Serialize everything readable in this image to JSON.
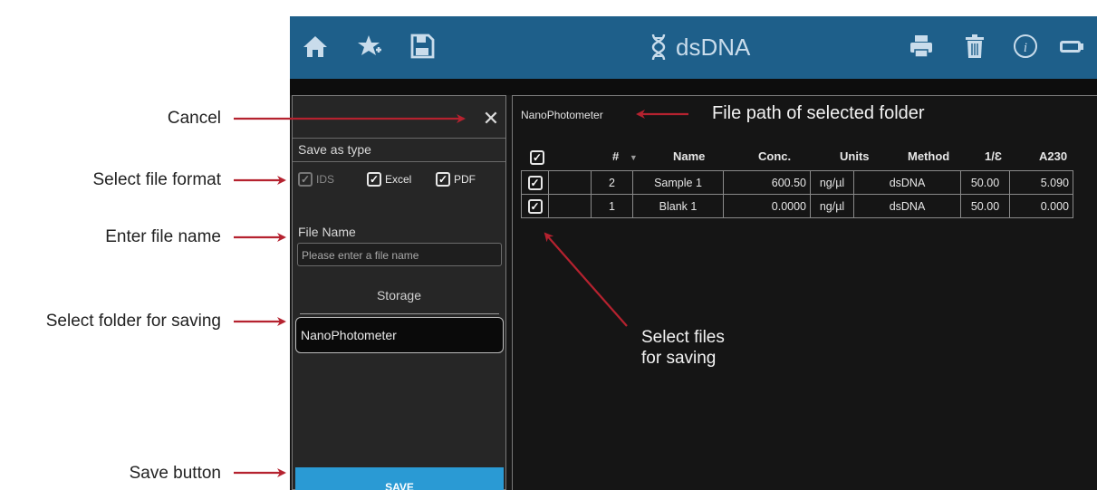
{
  "annotations": {
    "cancel": "Cancel",
    "select_file_format": "Select file format",
    "enter_file_name": "Enter file name",
    "select_folder": "Select folder for saving",
    "save_button": "Save button",
    "file_path": "File path of selected folder",
    "select_files_line1": "Select files",
    "select_files_line2": "for saving"
  },
  "topbar": {
    "title": "dsDNA",
    "left_icons": [
      "home-icon",
      "favorite-star-icon",
      "save-disk-icon"
    ],
    "right_icons": [
      "printer-icon",
      "trash-icon",
      "info-icon",
      "battery-icon"
    ],
    "color": "#1e5f8a"
  },
  "save_panel": {
    "save_as_type_label": "Save as type",
    "formats": [
      {
        "label": "IDS",
        "checked": true,
        "enabled": false
      },
      {
        "label": "Excel",
        "checked": true,
        "enabled": true
      },
      {
        "label": "PDF",
        "checked": true,
        "enabled": true
      }
    ],
    "file_name_label": "File Name",
    "file_name_placeholder": "Please enter a file name",
    "storage_label": "Storage",
    "selected_folder": "NanoPhotometer",
    "save_label": "SAVE",
    "save_color": "#2a9ad4"
  },
  "results": {
    "path": "NanoPhotometer",
    "columns": [
      "#",
      "Name",
      "Conc.",
      "Units",
      "Method",
      "1/Ɛ",
      "A230"
    ],
    "rows": [
      {
        "checked": true,
        "num": "2",
        "name": "Sample 1",
        "conc": "600.50",
        "units": "ng/µl",
        "method": "dsDNA",
        "e": "50.00",
        "a230": "5.090"
      },
      {
        "checked": true,
        "num": "1",
        "name": "Blank 1",
        "conc": "0.0000",
        "units": "ng/µl",
        "method": "dsDNA",
        "e": "50.00",
        "a230": "0.000"
      }
    ]
  },
  "colors": {
    "annotation_arrow": "#b5222f"
  }
}
